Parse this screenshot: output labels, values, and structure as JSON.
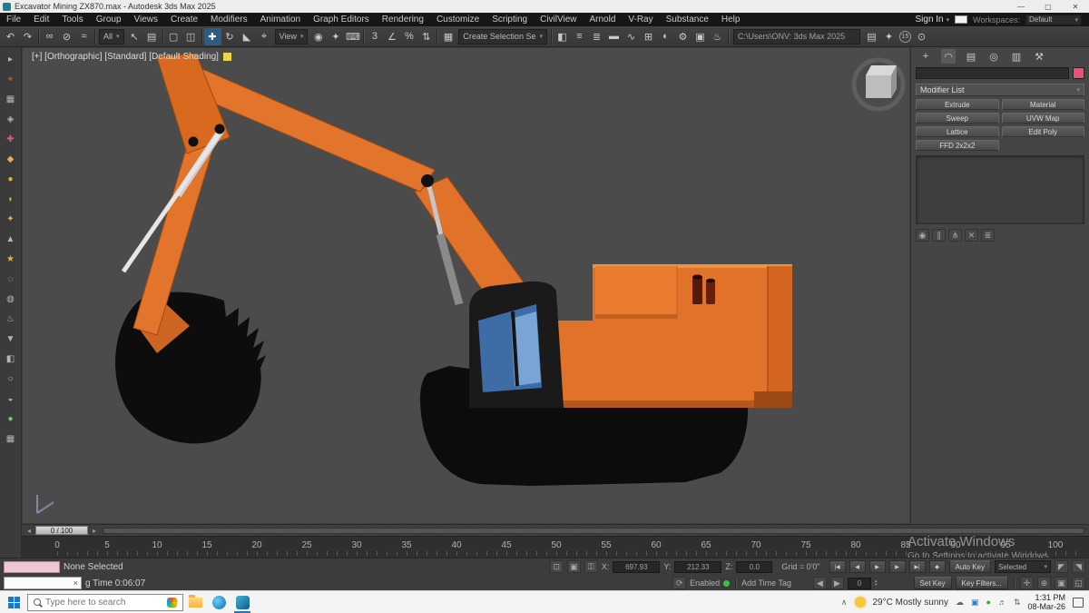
{
  "window": {
    "title": "Excavator Mining ZX870.max - Autodesk 3ds Max 2025",
    "minimize": "—",
    "maximize": "▢",
    "close": "✕"
  },
  "ui": {
    "caret": "▾",
    "x_close": "×",
    "spin_up": "▴",
    "spin_down": "▾",
    "chevron_up": "∧"
  },
  "menu": {
    "items": [
      "File",
      "Edit",
      "Tools",
      "Group",
      "Views",
      "Create",
      "Modifiers",
      "Animation",
      "Graph Editors",
      "Rendering",
      "Customize",
      "Scripting",
      "CivilView",
      "Arnold",
      "V-Ray",
      "Substance",
      "Help"
    ],
    "sign_in": "Sign In",
    "workspaces_label": "Workspaces:",
    "workspace_value": "Default"
  },
  "toolbar": {
    "icons": {
      "undo": "↶",
      "redo": "↷",
      "link": "∞",
      "unlink": "⊘",
      "bind": "≈",
      "select": "↖",
      "select_by_name": "▤",
      "rect_region": "▢",
      "crossing": "◫",
      "move": "✚",
      "rotate": "↻",
      "scale": "◣",
      "place": "⌖",
      "pivot": "◉",
      "manipulate": "✦",
      "keyboard": "⌨",
      "snap3": "3",
      "angle_snap": "∠",
      "percent_snap": "%",
      "spinner_snap": "⇅",
      "named_sets": "▦",
      "mirror": "◧",
      "align": "≡",
      "layers": "≣",
      "ribbon": "▬",
      "curve_editor": "∿",
      "schematic": "⊞",
      "material": "◐",
      "render_setup": "⚙",
      "rfw": "▣",
      "render": "♨",
      "explorer": "▤",
      "copilot": "✦",
      "search": "⊙"
    },
    "selection_filter": "All",
    "coord_system": "View",
    "named_selection": "Create Selection Se",
    "path": "C:\\Users\\ONV: 3ds Max 2025",
    "badge": "15"
  },
  "left_toolbar": {
    "icons": [
      "▸",
      "⌖",
      "▦",
      "◈",
      "✚",
      "◆",
      "●",
      "◗",
      "✦",
      "▲",
      "★",
      "◌",
      "◍",
      "♨",
      "▼",
      "◧",
      "○",
      "◒",
      "●",
      "▦"
    ]
  },
  "viewport": {
    "label": "[+] [Orthographic] [Standard] [Default Shading]"
  },
  "command_panel": {
    "tabs": {
      "create": "+",
      "modify": "◠",
      "hierarchy": "▤",
      "motion": "◎",
      "display": "▥",
      "utilities": "⚒"
    },
    "modifier_list": "Modifier List",
    "buttons": [
      "Extrude",
      "Material",
      "Sweep",
      "UVW Map",
      "Lattice",
      "Edit Poly",
      "FFD 2x2x2"
    ],
    "stack_tools": [
      "◉",
      "∥",
      "⋔",
      "✕",
      "≣"
    ],
    "object_color": "#ee4f75"
  },
  "timeslider": {
    "handle": "0 / 100",
    "left_arrow": "◂",
    "right_arrow": "▸"
  },
  "timeline": {
    "ticks": [
      "0",
      "5",
      "10",
      "15",
      "20",
      "25",
      "30",
      "35",
      "40",
      "45",
      "50",
      "55",
      "60",
      "65",
      "70",
      "75",
      "80",
      "85",
      "90",
      "95",
      "100"
    ]
  },
  "status": {
    "prompt": "None Selected",
    "listener_text": "g Time  0:06:07",
    "x_label": "X:",
    "y_label": "Y:",
    "z_label": "Z:",
    "x_value": "697.93",
    "y_value": "212.33",
    "z_value": "0.0",
    "grid": "Grid = 0'0\"",
    "auto_key": "Auto Key",
    "key_mode": "Selected",
    "set_key": "Set Key",
    "key_filters": "Key Filters...",
    "enabled_label": "Enabled",
    "add_time_tag": "Add Time Tag",
    "frame_spinner": "0",
    "icons": {
      "isolate": "⊡",
      "offset": "▣",
      "lock": "⚿",
      "tangent_in": "◤",
      "tangent_out": "◥",
      "mini_left": "◀",
      "mini_right": "▶",
      "time_config": "⟳",
      "nav_pan": "✛",
      "nav_zoom": "⊕",
      "nav_extents": "▣",
      "nav_region": "◱"
    }
  },
  "playback": {
    "goto_start": "|◀",
    "prev_frame": "◀",
    "play": "▶",
    "next_frame": "▶",
    "goto_end": "▶|",
    "key_toggle": "◆"
  },
  "watermark": {
    "line1": "Activate Windows",
    "line2": "Go to Settings to activate Windows."
  },
  "taskbar": {
    "search_placeholder": "Type here to search",
    "weather": "29°C  Mostly sunny",
    "tray": {
      "cloud": "☁",
      "app1": "▣",
      "app2": "●",
      "sound": "♬",
      "net": "⇅"
    },
    "time": "1:31 PM",
    "date": "08-Mar-26"
  },
  "colors": {
    "accent_orange": "#e0722a",
    "viewport_bg": "#4b4b4b",
    "cab_glass_blue": "#3d6ca6",
    "taskbar_bg": "#f4f4f4",
    "object_swatch_pink": "#ee4f75",
    "label_swatch_yellow": "#e9d848"
  }
}
